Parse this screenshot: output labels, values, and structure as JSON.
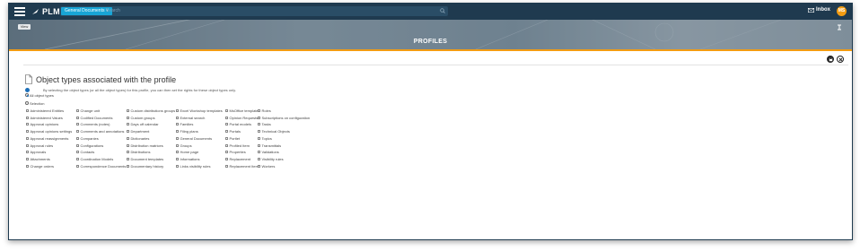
{
  "app": {
    "name": "PLM"
  },
  "topbar": {
    "doc_selector": "General Documents ˅",
    "search_placeholder": "Search",
    "inbox_label": "Inbox",
    "avatar_initials": "MS"
  },
  "banner": {
    "view_button": "View",
    "title": "PROFILES"
  },
  "section": {
    "title": "Object types associated with the profile",
    "info": "By selecting the object types (or all the object types) for this profile, you can then set the rights for these object types only.",
    "radio_all": "All object types",
    "radio_selection": "Selection"
  },
  "columns": [
    [
      "Administered Entities",
      "Administered Values",
      "Approval opinions",
      "Approval opinions settings",
      "Approval reassignments",
      "Approval rules",
      "Approvals",
      "Attachments",
      "Change orders"
    ],
    [
      "Change unit",
      "Codified Documents",
      "Comments (notes)",
      "Comments and annotations",
      "Companies",
      "Configurations",
      "Contacts",
      "Coordination Models",
      "Correspondence Documents"
    ],
    [
      "Custom distributions groups",
      "Custom groups",
      "Days off calendar",
      "Department",
      "Dictionaries",
      "Distribution matrices",
      "Distributions",
      "Document templates",
      "Documentary history"
    ],
    [
      "Excel Workshop templates",
      "External search",
      "Families",
      "Filing plans",
      "General Documents",
      "Groups",
      "Home page",
      "Informations",
      "Links visibility rules"
    ],
    [
      "MsOffice templates",
      "Opinion Requests",
      "Portal models",
      "Portals",
      "Portlet",
      "Profiled Item",
      "Properties",
      "Replacement",
      "Replacement Item"
    ],
    [
      "Roles",
      "Subscriptions on configuration",
      "Tasks",
      "Technical Objects",
      "Topics",
      "Transmittals",
      "Validations",
      "Visibility rules",
      "Workers"
    ]
  ],
  "colors": {
    "topbar": "#1f3a4f",
    "accent": "#f39c12",
    "selector": "#18a5d6"
  }
}
